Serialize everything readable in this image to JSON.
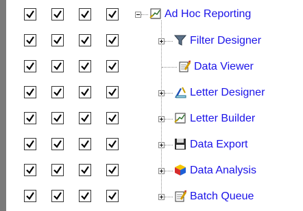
{
  "tree": {
    "root": {
      "label": "Ad Hoc Reporting",
      "expanded": true,
      "icon": "report-chart-icon"
    },
    "children": [
      {
        "label": "Filter Designer",
        "expandable": true,
        "icon": "filter-funnel-icon"
      },
      {
        "label": "Data Viewer",
        "expandable": false,
        "icon": "notepad-pencil-icon"
      },
      {
        "label": "Letter Designer",
        "expandable": true,
        "icon": "drafting-tools-icon"
      },
      {
        "label": "Letter Builder",
        "expandable": true,
        "icon": "report-chart-icon"
      },
      {
        "label": "Data Export",
        "expandable": true,
        "icon": "floppy-disk-icon"
      },
      {
        "label": "Data Analysis",
        "expandable": true,
        "icon": "cube-icon"
      },
      {
        "label": "Batch Queue",
        "expandable": true,
        "icon": "notepad-pencil-icon"
      }
    ]
  },
  "checkbox_columns": 4,
  "checkbox_rows": [
    [
      true,
      true,
      true,
      true
    ],
    [
      true,
      true,
      true,
      true
    ],
    [
      true,
      true,
      true,
      true
    ],
    [
      true,
      true,
      true,
      true
    ],
    [
      true,
      true,
      true,
      true
    ],
    [
      true,
      true,
      true,
      true
    ],
    [
      true,
      true,
      true,
      true
    ],
    [
      true,
      true,
      true,
      true
    ]
  ],
  "colors": {
    "link": "#1a12e8",
    "bar": "#7a7a7a"
  }
}
